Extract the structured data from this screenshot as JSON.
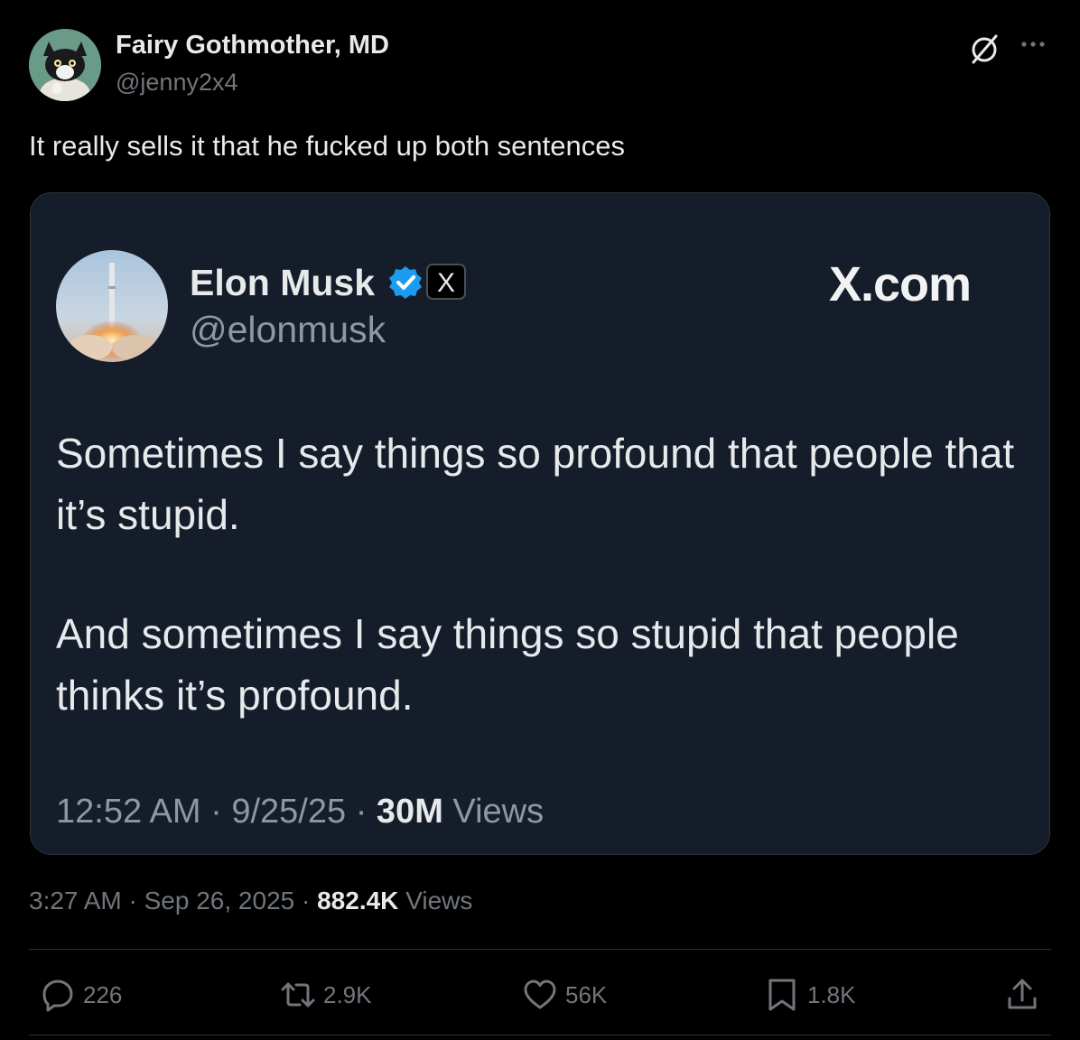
{
  "post": {
    "display_name": "Fairy Gothmother, MD",
    "handle": "@jenny2x4",
    "text": "It really sells it that he fucked up both sentences",
    "time": "3:27 AM",
    "date": "Sep 26, 2025",
    "views_count": "882.4K",
    "views_label": "Views",
    "icons": {
      "grok": "grok-icon",
      "more": "more-icon"
    }
  },
  "quote": {
    "display_name": "Elon Musk",
    "handle": "@elonmusk",
    "badge": "X",
    "site": "X.com",
    "paragraphs": [
      "Sometimes I say things so profound that people that it’s stupid.",
      "And sometimes I say things so stupid that people thinks it’s profound."
    ],
    "time": "12:52 AM",
    "date": "9/25/25",
    "views_count": "30M",
    "views_label": "Views",
    "verified_color": "#1d9bf0",
    "card_color": "#151d2a"
  },
  "actions": {
    "replies": "226",
    "reposts": "2.9K",
    "likes": "56K",
    "bookmarks": "1.8K",
    "icons": [
      "reply-icon",
      "repost-icon",
      "like-icon",
      "bookmark-icon",
      "share-icon"
    ]
  },
  "colors": {
    "background": "#000000",
    "text": "#e7e9ea",
    "muted": "#71767b",
    "border": "#2f3336"
  }
}
